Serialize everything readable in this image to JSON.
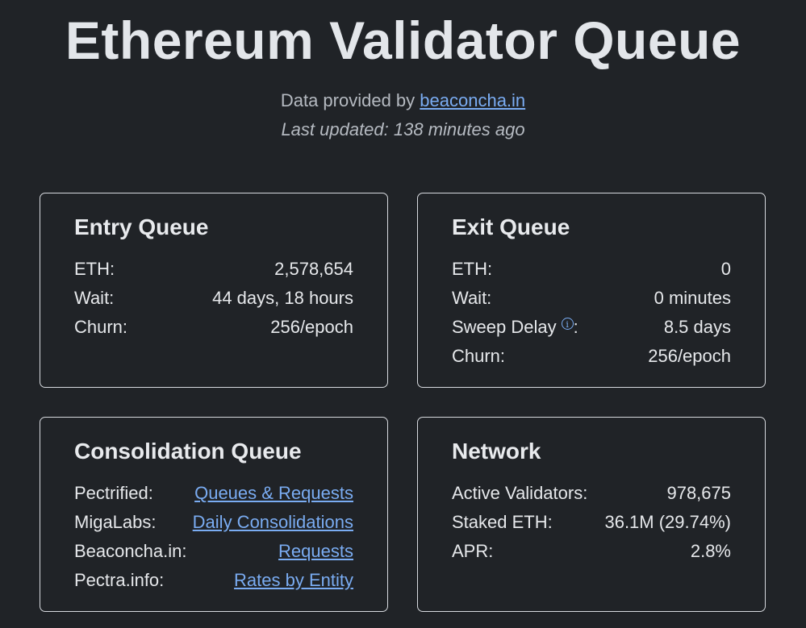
{
  "header": {
    "title": "Ethereum Validator Queue",
    "provider_prefix": "Data provided by",
    "provider_link": "beaconcha.in",
    "last_updated": "Last updated: 138 minutes ago"
  },
  "entry_queue": {
    "title": "Entry Queue",
    "rows": [
      {
        "label": "ETH:",
        "value": "2,578,654"
      },
      {
        "label": "Wait:",
        "value": "44 days, 18 hours"
      },
      {
        "label": "Churn:",
        "value": "256/epoch"
      }
    ]
  },
  "exit_queue": {
    "title": "Exit Queue",
    "eth": {
      "label": "ETH:",
      "value": "0"
    },
    "wait": {
      "label": "Wait:",
      "value": "0 minutes"
    },
    "sweep_delay": {
      "label": "Sweep Delay",
      "colon": ":",
      "icon": "info-icon",
      "value": "8.5 days"
    },
    "churn": {
      "label": "Churn:",
      "value": "256/epoch"
    }
  },
  "consolidation_queue": {
    "title": "Consolidation Queue",
    "rows": [
      {
        "label": "Pectrified:",
        "link": "Queues & Requests"
      },
      {
        "label": "MigaLabs:",
        "link": "Daily Consolidations"
      },
      {
        "label": "Beaconcha.in:",
        "link": "Requests"
      },
      {
        "label": "Pectra.info:",
        "link": "Rates by Entity"
      }
    ]
  },
  "network": {
    "title": "Network",
    "rows": [
      {
        "label": "Active Validators:",
        "value": "978,675"
      },
      {
        "label": "Staked ETH:",
        "value": "36.1M (29.74%)"
      },
      {
        "label": "APR:",
        "value": "2.8%"
      }
    ]
  },
  "colors": {
    "background": "#202327",
    "text": "#e6e8eb",
    "muted": "#b5bac1",
    "link": "#7aacf2",
    "card_border": "#d7dadf"
  }
}
